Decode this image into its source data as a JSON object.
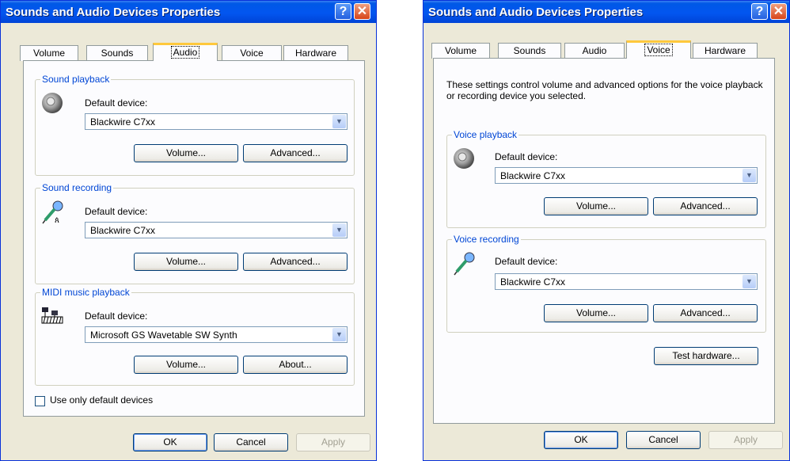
{
  "audio_window": {
    "title": "Sounds and Audio Devices Properties",
    "help_glyph": "?",
    "close_glyph": "✕",
    "tabs": [
      "Volume",
      "Sounds",
      "Audio",
      "Voice",
      "Hardware"
    ],
    "active_tab": "Audio",
    "sound_playback": {
      "label": "Sound playback",
      "device_label": "Default device:",
      "device": "Blackwire C7xx",
      "volume": "Volume...",
      "advanced": "Advanced..."
    },
    "sound_recording": {
      "label": "Sound recording",
      "device_label": "Default device:",
      "device": "Blackwire C7xx",
      "volume": "Volume...",
      "advanced": "Advanced..."
    },
    "midi_playback": {
      "label": "MIDI music playback",
      "device_label": "Default device:",
      "device": "Microsoft GS Wavetable SW Synth",
      "volume": "Volume...",
      "about": "About..."
    },
    "use_default_only": {
      "label": "Use only default devices",
      "checked": false
    },
    "ok": "OK",
    "cancel": "Cancel",
    "apply": "Apply"
  },
  "voice_window": {
    "title": "Sounds and Audio Devices Properties",
    "help_glyph": "?",
    "close_glyph": "✕",
    "tabs": [
      "Volume",
      "Sounds",
      "Audio",
      "Voice",
      "Hardware"
    ],
    "active_tab": "Voice",
    "intro": "These settings control volume and advanced options for the voice playback or recording device you selected.",
    "voice_playback": {
      "label": "Voice playback",
      "device_label": "Default device:",
      "device": "Blackwire C7xx",
      "volume": "Volume...",
      "advanced": "Advanced..."
    },
    "voice_recording": {
      "label": "Voice recording",
      "device_label": "Default device:",
      "device": "Blackwire C7xx",
      "volume": "Volume...",
      "advanced": "Advanced..."
    },
    "test_hardware": "Test hardware...",
    "ok": "OK",
    "cancel": "Cancel",
    "apply": "Apply"
  },
  "icons": {
    "speaker": "speaker-icon",
    "microphone": "microphone-icon",
    "midi": "midi-keyboard-icon",
    "dropdown": "chevron-down-icon"
  },
  "colors": {
    "titlebar": "#0054e3",
    "group_label": "#0046d5",
    "active_tab_accent": "#ffc83c",
    "dialog_bg": "#ece9d8"
  }
}
